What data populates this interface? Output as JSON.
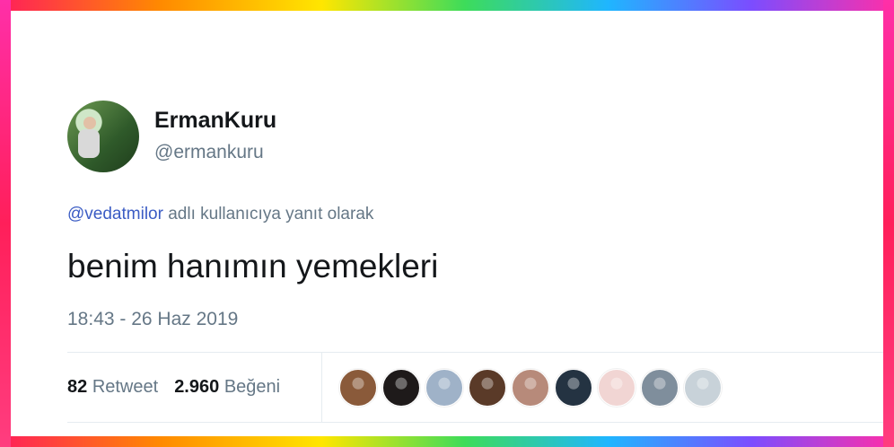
{
  "tweet": {
    "display_name": "ErmanKuru",
    "handle": "@ermankuru",
    "reply_mention": "@vedatmilor",
    "reply_text": " adlı kullanıcıya yanıt olarak",
    "text": "benim hanımın yemekleri",
    "timestamp": "18:43 - 26 Haz 2019",
    "retweet_count": "82",
    "retweet_label": "Retweet",
    "like_count": "2.960",
    "like_label": "Beğeni"
  },
  "colors": {
    "accent_link": "#3b5cc4",
    "muted_text": "#657786",
    "primary_text": "#14171a"
  },
  "likers": [
    {
      "name": "liker-avatar-1",
      "color": "#8a5a3a"
    },
    {
      "name": "liker-avatar-2",
      "color": "#1e1a1a"
    },
    {
      "name": "liker-avatar-3",
      "color": "#9fb2c8"
    },
    {
      "name": "liker-avatar-4",
      "color": "#5a3a28"
    },
    {
      "name": "liker-avatar-5",
      "color": "#b78a7a"
    },
    {
      "name": "liker-avatar-6",
      "color": "#243342"
    },
    {
      "name": "liker-avatar-7",
      "color": "#f1d5d3"
    },
    {
      "name": "liker-avatar-8",
      "color": "#7f8e9c"
    },
    {
      "name": "liker-avatar-9",
      "color": "#c8d2d9"
    }
  ]
}
